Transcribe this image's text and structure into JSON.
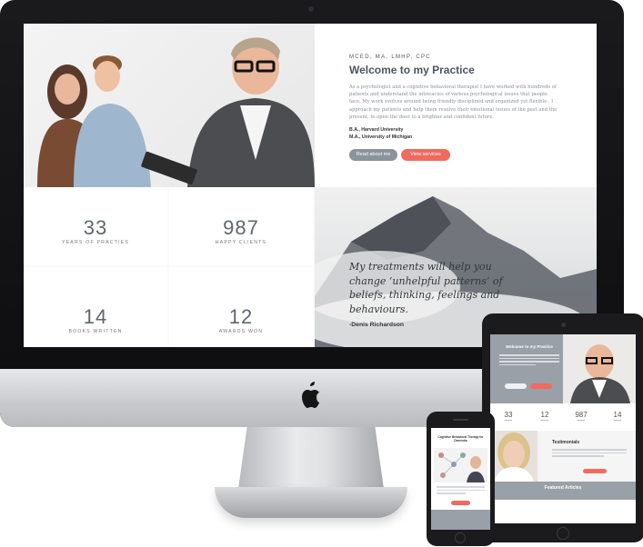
{
  "desktop": {
    "hero": {
      "credentials": "MCED, MA, LMHP, CPC",
      "title": "Welcome to my Practice",
      "text": "As a psychologist and a cognitive behavioral therapist I have worked with hundreds of patients and understand the intricacies of various psychological issues that people face. My work evolves around being friendly disciplined and organized yet flexible . I approach my patients and help them resolve their emotional issues of the past and the present, to open the door to a brighter and confident future.",
      "degree_1": "B.A., Harvard University",
      "degree_2": "M.A., University of Michigan",
      "button_read": "Read about me",
      "button_services": "View services"
    },
    "stats": [
      {
        "value": "33",
        "label": "YEARS OF PRACTIES"
      },
      {
        "value": "987",
        "label": "HAPPY CLIENTS"
      },
      {
        "value": "14",
        "label": "BOOKS WRITTEN"
      },
      {
        "value": "12",
        "label": "AWARDS WON"
      }
    ],
    "quote": {
      "text": "My treatments will help you change ‘unhelpful patterns’ of beliefs, thinking, feelings and behaviours.",
      "author": "-Denis Richardson"
    }
  },
  "tablet": {
    "hero_title": "Welcome to my Practice",
    "stats": [
      "33",
      "12",
      "987",
      "14"
    ],
    "testimonials_title": "Testimonials",
    "featured_title": "Featured Articles"
  },
  "phone": {
    "article_title": "Cognitive Behavioral Therapy for Dementia"
  },
  "colors": {
    "accent_red": "#ef6b5f",
    "button_gray": "#8d939b",
    "text_dark": "#4c5460"
  }
}
